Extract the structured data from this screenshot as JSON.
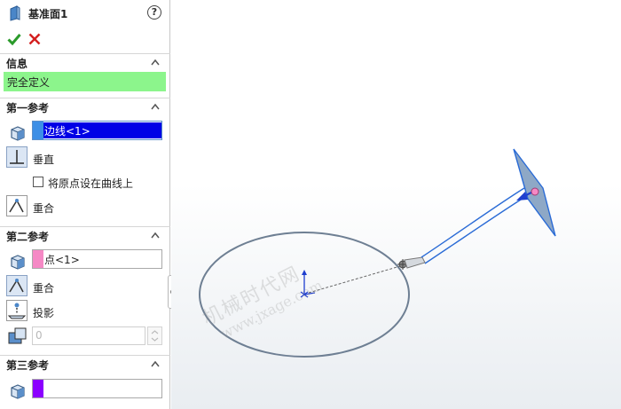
{
  "panel": {
    "title": "基准面1",
    "help_label": "?",
    "info": {
      "header": "信息",
      "status": "完全定义",
      "status_color": "#8cf58c"
    },
    "ref1": {
      "header": "第一参考",
      "value": "边线<1>",
      "swatch_color": "#3d8fe6",
      "highlight_color": "#0000e6",
      "option_perpendicular": "垂直",
      "checkbox_label": "将原点设在曲线上",
      "option_coincident": "重合"
    },
    "ref2": {
      "header": "第二参考",
      "value": "点<1>",
      "swatch_color": "#f589c5",
      "option_coincident": "重合",
      "option_projection": "投影",
      "spin_value": "0"
    },
    "ref3": {
      "header": "第三参考",
      "value": "",
      "swatch_color": "#8b00ff"
    }
  },
  "watermark": {
    "line1": "机械时代网",
    "line2": "www.jxage.com"
  }
}
